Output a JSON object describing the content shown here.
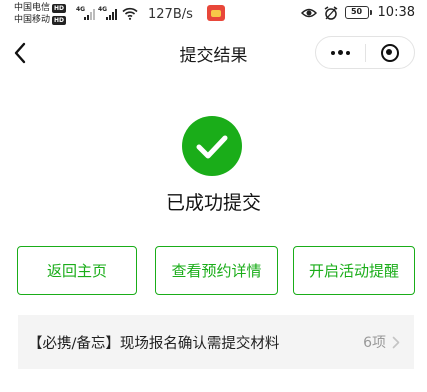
{
  "status_bar": {
    "carrier1": "中国电信",
    "carrier2": "中国移动",
    "hd_badge": "HD",
    "signal_tag": "4G",
    "net_speed": "127B/s",
    "battery": "50",
    "time": "10:38"
  },
  "nav": {
    "title": "提交结果"
  },
  "result": {
    "text": "已成功提交",
    "success_color": "#1aad19"
  },
  "actions": {
    "home": "返回主页",
    "detail": "查看预约详情",
    "remind": "开启活动提醒"
  },
  "materials": {
    "label": "【必携/备忘】现场报名确认需提交材料",
    "count": "6项"
  },
  "icons": [
    "back-icon",
    "more-icon",
    "close-icon",
    "check-icon",
    "chevron-right-icon",
    "wifi-icon",
    "eye-icon",
    "alarm-icon"
  ]
}
